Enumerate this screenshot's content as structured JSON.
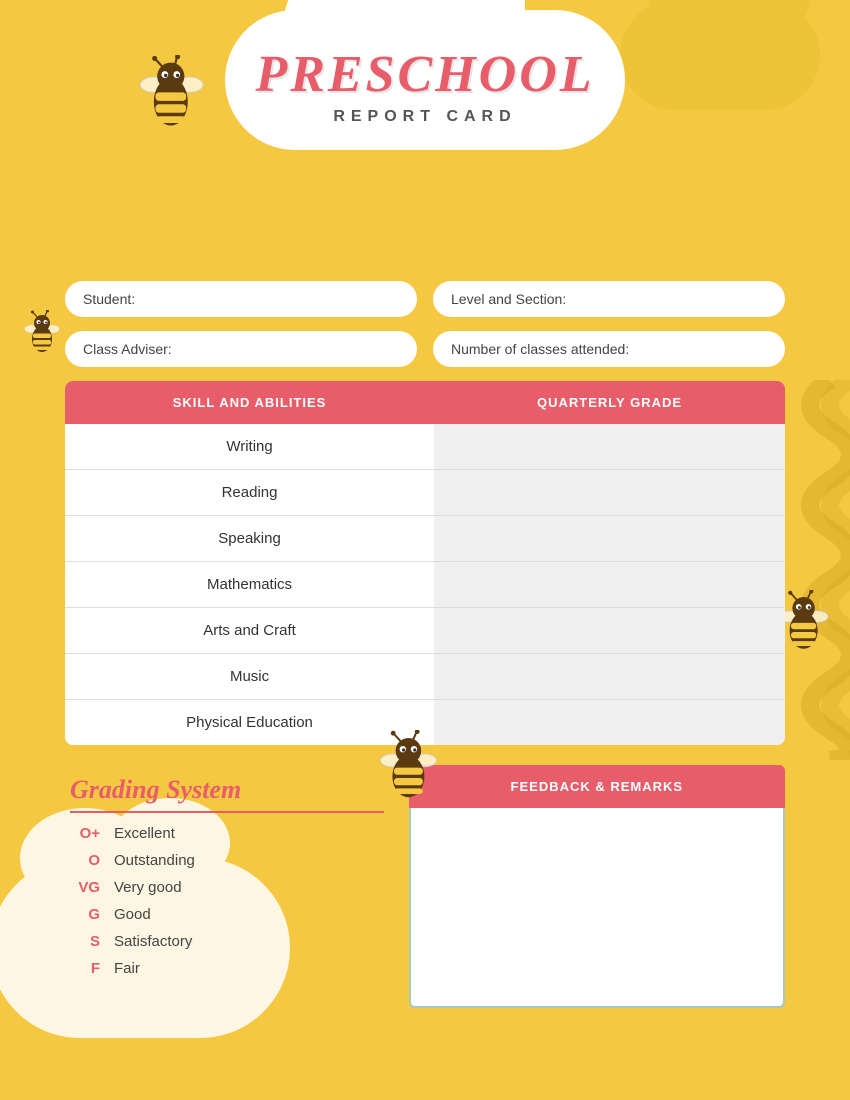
{
  "header": {
    "title": "PRESCHOOL",
    "subtitle": "REPORT CARD"
  },
  "fields": {
    "student_label": "Student:",
    "level_label": "Level and Section:",
    "adviser_label": "Class Adviser:",
    "classes_label": "Number of classes attended:"
  },
  "table": {
    "col1": "SKILL AND ABILITIES",
    "col2": "QUARTERLY GRADE",
    "rows": [
      {
        "skill": "Writing"
      },
      {
        "skill": "Reading"
      },
      {
        "skill": "Speaking"
      },
      {
        "skill": "Mathematics"
      },
      {
        "skill": "Arts and Craft"
      },
      {
        "skill": "Music"
      },
      {
        "skill": "Physical Education"
      }
    ]
  },
  "grading": {
    "title": "Grading System",
    "items": [
      {
        "code": "O+",
        "desc": "Excellent"
      },
      {
        "code": "O",
        "desc": "Outstanding"
      },
      {
        "code": "VG",
        "desc": "Very good"
      },
      {
        "code": "G",
        "desc": "Good"
      },
      {
        "code": "S",
        "desc": "Satisfactory"
      },
      {
        "code": "F",
        "desc": "Fair"
      }
    ]
  },
  "feedback": {
    "header": "FEEDBACK & REMARKS"
  }
}
